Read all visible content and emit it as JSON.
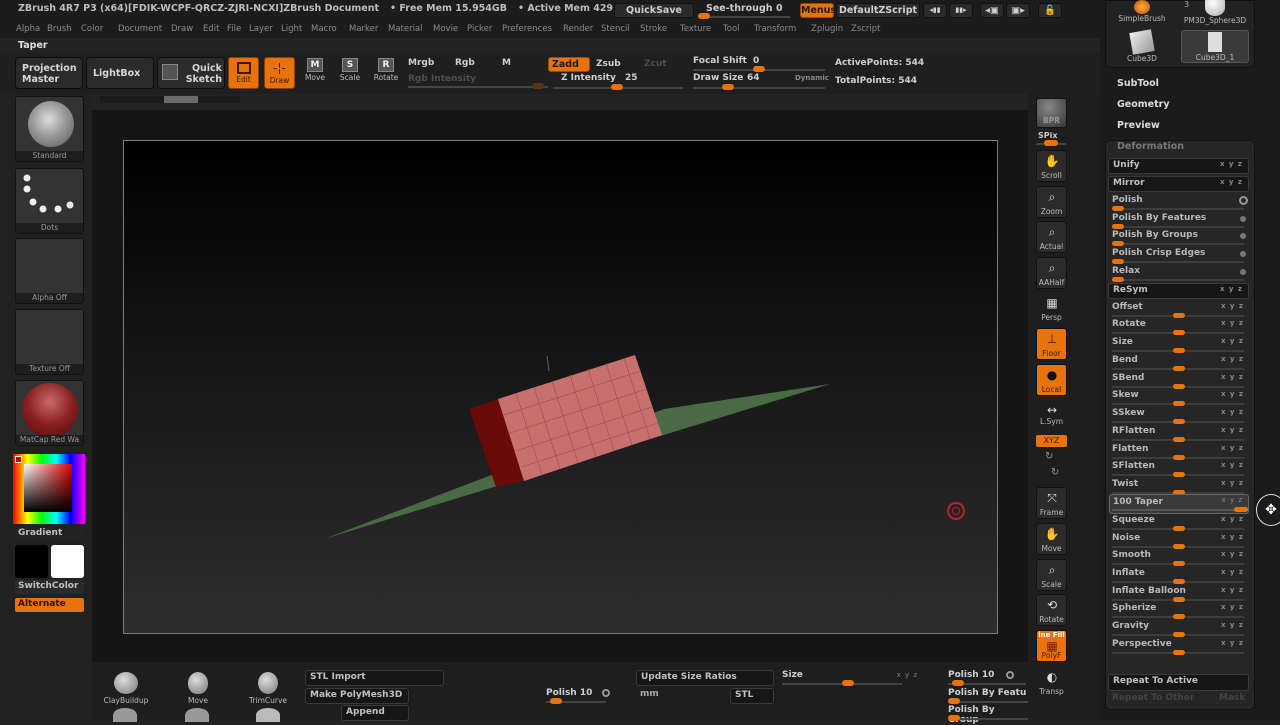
{
  "title_bar": {
    "app_title": "ZBrush 4R7 P3 (x64)[FDIK-WCPF-QRCZ-ZJRI-NCXI]ZBrush Document",
    "free_mem": "• Free Mem 15.954GB",
    "active_mem": "• Active Mem 429",
    "quicksave": "QuickSave",
    "see_through_label": "See-through",
    "see_through_value": "0",
    "menus": "Menus",
    "default_zscript": "DefaultZScript"
  },
  "menu_bar": [
    "Alpha",
    "Brush",
    "Color",
    "Document",
    "Draw",
    "Edit",
    "File",
    "Layer",
    "Light",
    "Macro",
    "Marker",
    "Material",
    "Movie",
    "Picker",
    "Preferences",
    "Render",
    "Stencil",
    "Stroke",
    "Texture",
    "Tool",
    "Transform",
    "Zplugin",
    "Zscript"
  ],
  "palette_title": "Taper",
  "toolbar": {
    "projection_master": "Projection Master",
    "lightbox": "LightBox",
    "quick_sketch": "Quick Sketch",
    "edit": "Edit",
    "draw": "Draw",
    "move": "Move",
    "scale": "Scale",
    "rotate": "Rotate",
    "move_glyph": "M",
    "scale_glyph": "S",
    "rotate_glyph": "R",
    "mrgb": "Mrgb",
    "rgb": "Rgb",
    "m": "M",
    "rgb_intensity": "Rgb Intensity",
    "zadd": "Zadd",
    "zsub": "Zsub",
    "zcut": "Zcut",
    "z_intensity_label": "Z Intensity",
    "z_intensity": "25",
    "focal_shift_label": "Focal Shift",
    "focal_shift": "0",
    "draw_size_label": "Draw Size",
    "draw_size": "64",
    "dynamic": "Dynamic",
    "active_points": "ActivePoints: 544",
    "total_points": "TotalPoints: 544"
  },
  "left_shelf": {
    "brush": "Standard",
    "stroke": "Dots",
    "alpha": "Alpha Off",
    "texture": "Texture Off",
    "material": "MatCap Red Wa",
    "gradient": "Gradient",
    "switch_color": "SwitchColor",
    "alternate": "Alternate"
  },
  "right_shelf": [
    {
      "label": "SPix",
      "icon": "bpr-icon"
    },
    {
      "label": "Scroll",
      "icon": "hand-icon"
    },
    {
      "label": "Zoom",
      "icon": "magnifier-icon"
    },
    {
      "label": "Actual",
      "icon": "magnifier-icon"
    },
    {
      "label": "AAHalf",
      "icon": "magnifier-icon"
    },
    {
      "label": "Persp",
      "icon": "grid-icon"
    },
    {
      "label": "Floor",
      "icon": "floor-icon"
    },
    {
      "label": "Local",
      "icon": "local-icon"
    },
    {
      "label": "L.Sym",
      "icon": "symmetry-icon"
    },
    {
      "label": "XYZ",
      "icon": "xyz-icon"
    },
    {
      "label": "Frame",
      "icon": "frame-icon"
    },
    {
      "label": "Move",
      "icon": "hand-icon"
    },
    {
      "label": "Scale",
      "icon": "magnifier-icon"
    },
    {
      "label": "Rotate",
      "icon": "rotate-icon"
    },
    {
      "label": "PolyF",
      "icon": "polyframe-icon"
    },
    {
      "label": "Transp",
      "icon": "transparency-icon"
    }
  ],
  "bpr": "BPR",
  "line_fill": "ine Fill",
  "tool_thumbs": [
    {
      "label": "SimpleBrush"
    },
    {
      "label": "PM3D_Sphere3D"
    },
    {
      "label": "Cube3D"
    },
    {
      "label": "Cube3D_1"
    }
  ],
  "tool_count": "3",
  "tool_sections": [
    "SubTool",
    "Geometry",
    "Preview"
  ],
  "deformation": {
    "title": "Deformation",
    "items": [
      {
        "name": "Unify",
        "type": "button",
        "axes": "x y z"
      },
      {
        "name": "Mirror",
        "type": "button",
        "axes": "x y z"
      },
      {
        "name": "Polish",
        "type": "slider",
        "value": 0,
        "indicator": "ring"
      },
      {
        "name": "Polish By Features",
        "type": "slider",
        "value": 0,
        "indicator": "dot"
      },
      {
        "name": "Polish By Groups",
        "type": "slider",
        "value": 0,
        "indicator": "dot"
      },
      {
        "name": "Polish Crisp Edges",
        "type": "slider",
        "value": 0,
        "indicator": "dot"
      },
      {
        "name": "Relax",
        "type": "slider",
        "value": 0,
        "indicator": "dot"
      },
      {
        "name": "ReSym",
        "type": "button",
        "axes": "x y z"
      },
      {
        "name": "Offset",
        "type": "slider",
        "value": 0,
        "axes": "x y z"
      },
      {
        "name": "Rotate",
        "type": "slider",
        "value": 0,
        "axes": "x y z"
      },
      {
        "name": "Size",
        "type": "slider",
        "value": 0,
        "axes": "x y z"
      },
      {
        "name": "Bend",
        "type": "slider",
        "value": 0,
        "axes": "x y z"
      },
      {
        "name": "SBend",
        "type": "slider",
        "value": 0,
        "axes": "x y z"
      },
      {
        "name": "Skew",
        "type": "slider",
        "value": 0,
        "axes": "x y z"
      },
      {
        "name": "SSkew",
        "type": "slider",
        "value": 0,
        "axes": "x y z"
      },
      {
        "name": "RFlatten",
        "type": "slider",
        "value": 0,
        "axes": "x y z"
      },
      {
        "name": "Flatten",
        "type": "slider",
        "value": 0,
        "axes": "x y z"
      },
      {
        "name": "SFlatten",
        "type": "slider",
        "value": 0,
        "axes": "x y z"
      },
      {
        "name": "Twist",
        "type": "slider",
        "value": 0,
        "axes": "x y z"
      },
      {
        "name": "Taper",
        "type": "slider",
        "value": 100,
        "display": "100 Taper",
        "axes": "x y z",
        "active": true
      },
      {
        "name": "Squeeze",
        "type": "slider",
        "value": 0,
        "axes": "x y z"
      },
      {
        "name": "Noise",
        "type": "slider",
        "value": 0,
        "axes": "x y z"
      },
      {
        "name": "Smooth",
        "type": "slider",
        "value": 0,
        "axes": "x y z"
      },
      {
        "name": "Inflate",
        "type": "slider",
        "value": 0,
        "axes": "x y z"
      },
      {
        "name": "Inflate Balloon",
        "type": "slider",
        "value": 0,
        "axes": "x y z"
      },
      {
        "name": "Spherize",
        "type": "slider",
        "value": 0,
        "axes": "x y z"
      },
      {
        "name": "Gravity",
        "type": "slider",
        "value": 0,
        "axes": "x y z"
      },
      {
        "name": "Perspective",
        "type": "slider",
        "value": 0,
        "axes": "x y z"
      }
    ],
    "repeat_to_active": "Repeat To Active",
    "repeat_to_other": "Repeat To Other",
    "mask": "Mask"
  },
  "bottom": {
    "brushes": [
      "ClayBuildup",
      "Move",
      "TrimCurve"
    ],
    "stl_import": "STL Import",
    "make_polymesh": "Make PolyMesh3D",
    "append": "Append",
    "polish_label": "Polish",
    "polish_value": "10",
    "update_size_ratios": "Update Size Ratios",
    "unit": "mm",
    "stl": "STL",
    "size": "Size",
    "axes": "x y z",
    "polish2": "Polish 10",
    "polish_by_features": "Polish By Featu",
    "polish_by_groups": "Polish By Group"
  },
  "colors": {
    "accent": "#e8720c",
    "mesh": "#c87070",
    "floor": "#4a6a46"
  }
}
